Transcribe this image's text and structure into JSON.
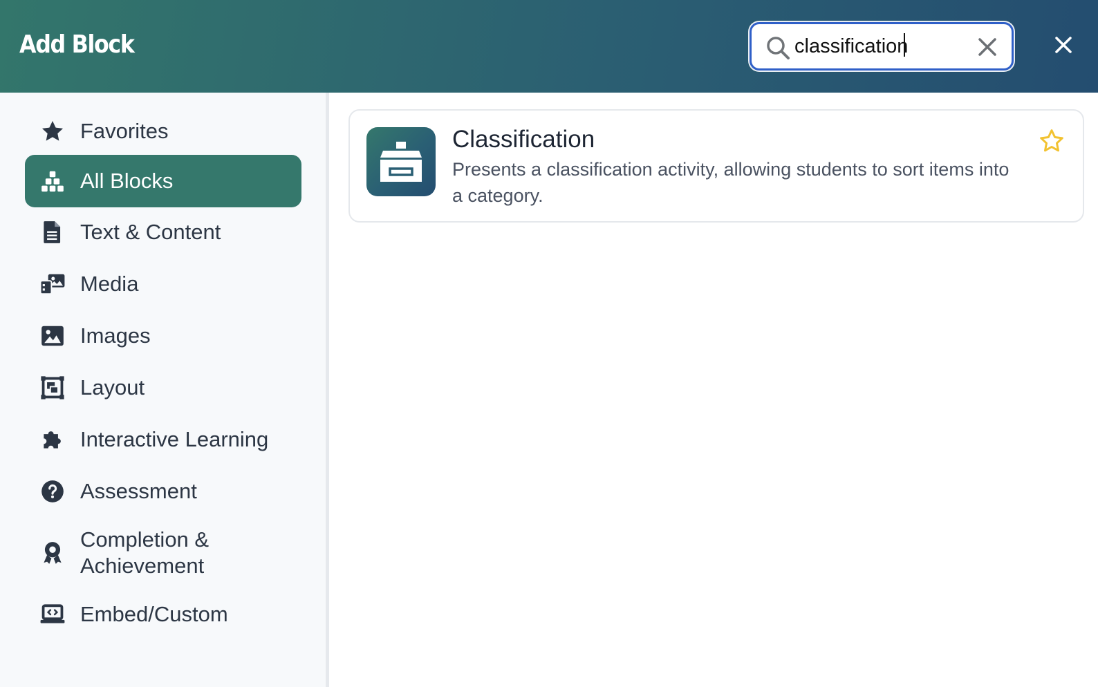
{
  "header": {
    "title": "Add Block",
    "search": {
      "value": "classification",
      "placeholder": ""
    },
    "icons": {
      "search": "search-icon",
      "clear": "clear-icon",
      "close": "close-icon"
    }
  },
  "sidebar": {
    "items": [
      {
        "label": "Favorites",
        "icon": "star-icon",
        "active": false
      },
      {
        "label": "All Blocks",
        "icon": "blocks-icon",
        "active": true
      },
      {
        "label": "Text & Content",
        "icon": "document-icon",
        "active": false
      },
      {
        "label": "Media",
        "icon": "media-icon",
        "active": false
      },
      {
        "label": "Images",
        "icon": "image-icon",
        "active": false
      },
      {
        "label": "Layout",
        "icon": "layout-icon",
        "active": false
      },
      {
        "label": "Interactive Learning",
        "icon": "puzzle-icon",
        "active": false
      },
      {
        "label": "Assessment",
        "icon": "question-circle-icon",
        "active": false
      },
      {
        "label": "Completion & Achievement",
        "icon": "award-icon",
        "active": false
      },
      {
        "label": "Embed/Custom",
        "icon": "laptop-code-icon",
        "active": false
      }
    ]
  },
  "results": [
    {
      "title": "Classification",
      "description": "Presents a classification activity, allowing students to sort items into a category.",
      "icon": "archive-box-icon",
      "favorite_icon": "star-outline-icon"
    }
  ],
  "colors": {
    "accent": "#35786c",
    "header_start": "#33766b",
    "header_end": "#244d70",
    "focus_ring": "#2f5fc8",
    "star": "#f2c230",
    "text": "#2c3644"
  }
}
